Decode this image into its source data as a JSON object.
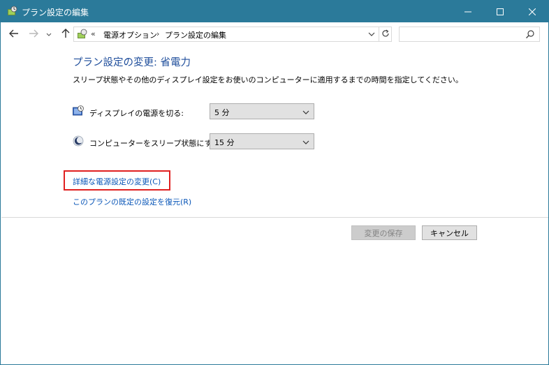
{
  "window": {
    "title": "プラン設定の編集",
    "icon": "power-options-icon",
    "controls": [
      "minimize-icon",
      "maximize-icon",
      "close-icon"
    ]
  },
  "navbar": {
    "back_icon": "arrow-left-icon",
    "forward_icon": "arrow-right-icon",
    "recent_icon": "chevron-down-icon",
    "up_icon": "arrow-up-icon",
    "address": {
      "overflow": "«",
      "crumbs": [
        "電源オプション",
        "プラン設定の編集"
      ],
      "separator": "›",
      "dropdown_icon": "chevron-down-icon",
      "refresh_icon": "refresh-icon"
    },
    "search": {
      "placeholder": "",
      "value": "",
      "icon": "search-icon"
    }
  },
  "content": {
    "heading": "プラン設定の変更: 省電力",
    "description": "スリープ状態やその他のディスプレイ設定をお使いのコンピューターに適用するまでの時間を指定してください。",
    "settings": [
      {
        "label": "ディスプレイの電源を切る:",
        "value": "5 分",
        "icon": "display-timer-icon"
      },
      {
        "label": "コンピューターをスリープ状態にする:",
        "value": "15 分",
        "icon": "sleep-moon-icon"
      }
    ],
    "links": {
      "advanced": "詳細な電源設定の変更(C)",
      "restore": "このプランの既定の設定を復元(R)"
    }
  },
  "buttons": {
    "save": "変更の保存",
    "cancel": "キャンセル"
  },
  "colors": {
    "titlebar": "#2b7a9a",
    "heading": "#1e4d9b",
    "link": "#0b57b8",
    "highlight": "#e02020"
  }
}
